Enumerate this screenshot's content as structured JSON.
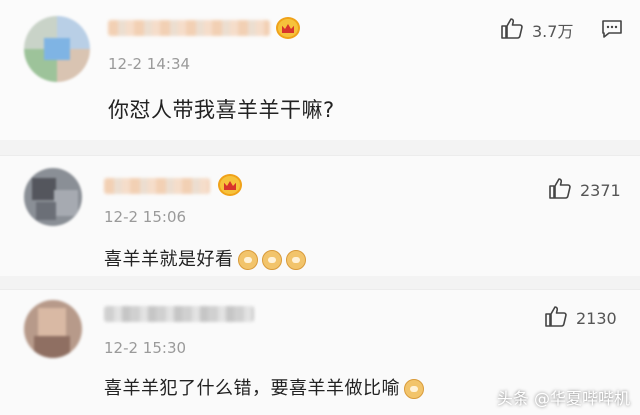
{
  "comments": [
    {
      "time": "12-2 14:34",
      "text": "你怼人带我喜羊羊干嘛?",
      "likes": "3.7万",
      "emoji_count": 0
    },
    {
      "time": "12-2 15:06",
      "text": "喜羊羊就是好看",
      "likes": "2371",
      "emoji_count": 3
    },
    {
      "time": "12-2 15:30",
      "text": "喜羊羊犯了什么错，要喜羊羊做比喻",
      "likes": "2130",
      "emoji_count": 1
    }
  ],
  "icons": {
    "like": "thumbs-up-icon",
    "reply": "reply-icon",
    "badge": "crown-badge-icon",
    "emoji": "emoji-icon"
  },
  "watermark": "头条 @华夏哔哔机",
  "colors": {
    "background": "#f3f3f3",
    "card": "#fafafa",
    "time": "#9a9a9a",
    "text": "#222222"
  }
}
